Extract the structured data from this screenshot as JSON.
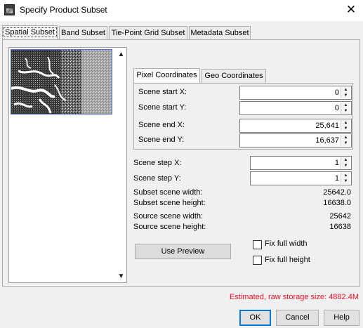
{
  "window": {
    "title": "Specify Product Subset",
    "close_glyph": "✕",
    "icon": "snap-app-icon"
  },
  "tabs": [
    {
      "label": "Spatial Subset",
      "active": true
    },
    {
      "label": "Band Subset",
      "active": false
    },
    {
      "label": "Tie-Point Grid Subset",
      "active": false
    },
    {
      "label": "Metadata Subset",
      "active": false
    }
  ],
  "thumbnail": {
    "scroll_up": "▲",
    "scroll_down": "▼"
  },
  "coord_tabs": [
    {
      "label": "Pixel Coordinates",
      "active": true
    },
    {
      "label": "Geo Coordinates",
      "active": false
    }
  ],
  "pixel_fields": [
    {
      "label": "Scene start X:",
      "value": "0"
    },
    {
      "label": "Scene start Y:",
      "value": "0"
    },
    {
      "label": "Scene end X:",
      "value": "25,641"
    },
    {
      "label": "Scene end Y:",
      "value": "16,637"
    }
  ],
  "step_fields": [
    {
      "label": "Scene step X:",
      "value": "1"
    },
    {
      "label": "Scene step Y:",
      "value": "1"
    }
  ],
  "info_rows": [
    {
      "label": "Subset scene width:",
      "value": "25642.0"
    },
    {
      "label": "Subset scene height:",
      "value": "16638.0"
    },
    {
      "label": "Source scene width:",
      "value": "25642"
    },
    {
      "label": "Source scene height:",
      "value": "16638"
    }
  ],
  "preview_button": "Use Preview",
  "checkboxes": [
    {
      "label": "Fix full width",
      "checked": false
    },
    {
      "label": "Fix full height",
      "checked": false
    }
  ],
  "storage_estimate": "Estimated, raw storage size: 4882.4M",
  "storage_color": "#e81123",
  "buttons": {
    "ok": "OK",
    "cancel": "Cancel",
    "help": "Help"
  },
  "spinner_arrows": {
    "up": "▲",
    "down": "▼"
  }
}
